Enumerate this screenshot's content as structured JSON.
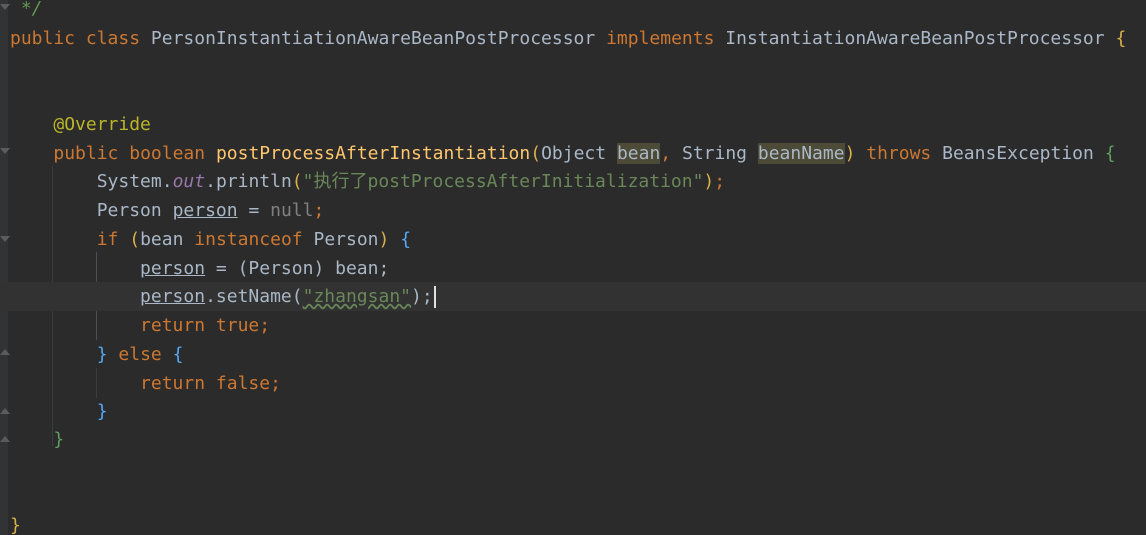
{
  "editor": {
    "lines": {
      "l0": {
        "comment": " */"
      },
      "l1": {
        "kw1": "public",
        "kw2": "class",
        "name": "PersonInstantiationAwareBeanPostProcessor",
        "kw3": "implements",
        "iface": "InstantiationAwareBeanPostProcessor",
        "brace": "{"
      },
      "l4": {
        "annotation": "@Override"
      },
      "l5": {
        "kw1": "public",
        "kw2": "boolean",
        "method": "postProcessAfterInstantiation",
        "p_open": "(",
        "type1": "Object",
        "param1": "bean",
        "comma": ",",
        "type2": "String",
        "param2": "beanName",
        "p_close": ")",
        "kw3": "throws",
        "exc": "BeansException",
        "brace": "{"
      },
      "l6": {
        "cls": "System",
        "dot1": ".",
        "field": "out",
        "dot2": ".",
        "call": "println",
        "p_open": "(",
        "str": "\"执行了postProcessAfterInitialization\"",
        "p_close": ")",
        "semi": ";"
      },
      "l7": {
        "type": "Person",
        "var": "person",
        "eq": " = ",
        "nul": "null",
        "semi": ";"
      },
      "l8": {
        "kw": "if",
        "cond_open": "(",
        "cond": "bean ",
        "kw2": "instanceof",
        "cond_type": " Person",
        "cond_close": ")",
        "brace": "{"
      },
      "l9": {
        "var": "person",
        "rest": " = (Person) bean;"
      },
      "l10": {
        "var": "person",
        "call": ".setName(",
        "str": "\"zhangsan\"",
        "close": ");"
      },
      "l11": {
        "kw": "return",
        "val": "true",
        "semi": ";"
      },
      "l12": {
        "close": "}",
        "kw": "else",
        "brace": "{"
      },
      "l13": {
        "kw": "return",
        "val": "false",
        "semi": ";"
      },
      "l14": {
        "close": "}"
      },
      "l15": {
        "close": "}"
      },
      "l18": {
        "close": "}"
      }
    }
  },
  "colors": {
    "background": "#2b2b2b",
    "keyword": "#cc7832",
    "annotation": "#bbb529",
    "method": "#ffc66d",
    "string": "#6a8759",
    "text": "#a9b7c6",
    "field": "#9876aa"
  }
}
